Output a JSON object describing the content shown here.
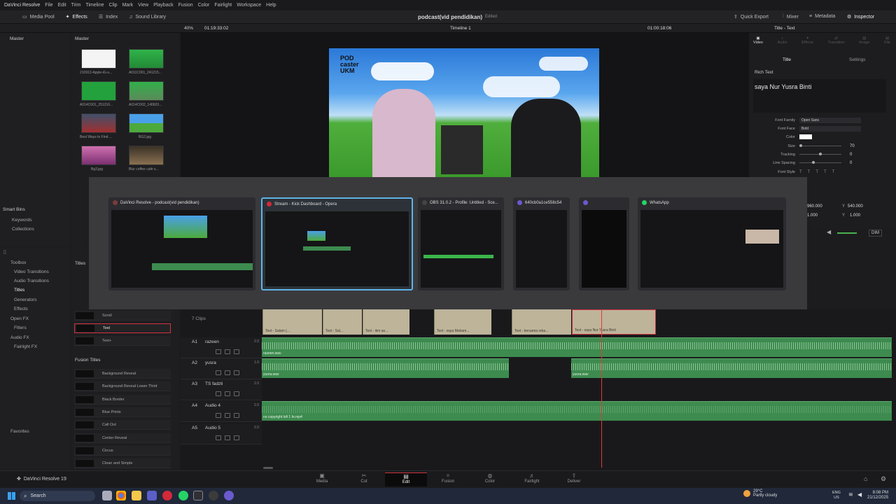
{
  "app": {
    "name": "DaVinci Resolve",
    "project_title": "podcast(vid pendidikan)",
    "edited": "Edited",
    "brand": "DaVinci Resolve 19"
  },
  "menu": [
    "File",
    "Edit",
    "Trim",
    "Timeline",
    "Clip",
    "Mark",
    "View",
    "Playback",
    "Fusion",
    "Color",
    "Fairlight",
    "Workspace",
    "Help"
  ],
  "toolbar": {
    "media_pool": "Media Pool",
    "effects": "Effects",
    "index": "Index",
    "sound_library": "Sound Library",
    "quick_export": "Quick Export",
    "mixer": "Mixer",
    "metadata": "Metadata",
    "inspector": "Inspector"
  },
  "viewer": {
    "zoom": "40%",
    "timecode_left": "01:19:33:02",
    "timeline_name": "Timeline 1",
    "timecode_right": "01:00:18:06",
    "logo_lines": [
      "POD",
      "caster",
      "UKM"
    ]
  },
  "media_pool": {
    "master": "Master",
    "master_bin": "Master",
    "clips": [
      {
        "name": "210912-Apple-iG-s..."
      },
      {
        "name": "A011C001_241215..."
      },
      {
        "name": "A014C001_251216..."
      },
      {
        "name": "A014C002_140620..."
      },
      {
        "name": "Best Ways to Find ..."
      },
      {
        "name": "BG2.jpg"
      },
      {
        "name": "Bg3.jpg"
      },
      {
        "name": "Blur coffee cafe s..."
      }
    ],
    "smart_bins": "Smart Bins",
    "smart_items": [
      "Keywords",
      "Collections"
    ]
  },
  "effects": {
    "tree": [
      {
        "label": "Toolbox"
      },
      {
        "label": "Video Transitions"
      },
      {
        "label": "Audio Transitions"
      },
      {
        "label": "Titles"
      },
      {
        "label": "Generators"
      },
      {
        "label": "Effects"
      },
      {
        "label": "Open FX"
      },
      {
        "label": "Filters"
      },
      {
        "label": "Audio FX"
      },
      {
        "label": "Fairlight FX"
      }
    ],
    "favorites": "Favorites",
    "titles_header": "Titles",
    "titles": [
      "Scroll",
      "Text",
      "Text+"
    ],
    "fusion_header": "Fusion Titles",
    "fusion_titles": [
      "Background Reveal",
      "Background Reveal Lower Third",
      "Black Border",
      "Blue Prints",
      "Call Out",
      "Center Reveal",
      "Circus",
      "Clean and Simple"
    ]
  },
  "timeline": {
    "clip_count": "7 Clips",
    "text_clips": [
      "Text - Salam (...",
      "Text - Sal...",
      "Text - ikm as...",
      "Text - saya Muham...",
      "Text - bersama reka...",
      "Text - saya Nur Yusra Binti"
    ],
    "tracks": [
      {
        "id": "A1",
        "name": "razeen",
        "ch": "2.0",
        "clips": [
          "razeen.wav"
        ]
      },
      {
        "id": "A2",
        "name": "yusra",
        "ch": "1.0",
        "clips": [
          "yusra.wav",
          "yusra.wav"
        ]
      },
      {
        "id": "A3",
        "name": "TS fadzli",
        "ch": "2.0",
        "clips": []
      },
      {
        "id": "A4",
        "name": "Audio 4",
        "ch": "2.0",
        "clips": [
          "no copyright lofi 1 hr.mp4"
        ]
      },
      {
        "id": "A5",
        "name": "Audio 5",
        "ch": "2.0",
        "clips": []
      }
    ]
  },
  "inspector": {
    "title": "Title - Text",
    "tabs": [
      "Video",
      "Audio",
      "Effects",
      "Transition",
      "Image",
      "File"
    ],
    "subtabs": [
      "Title",
      "Settings"
    ],
    "section": "Rich Text",
    "text_value": "saya Nur Yusra Binti",
    "rows": [
      {
        "label": "Font Family",
        "value": "Open Sans"
      },
      {
        "label": "Font Face",
        "value": "Bold"
      },
      {
        "label": "Color",
        "value": ""
      },
      {
        "label": "Size",
        "value": "70"
      },
      {
        "label": "Tracking",
        "value": "0"
      },
      {
        "label": "Line Spacing",
        "value": "0"
      },
      {
        "label": "Font Style",
        "value": ""
      }
    ],
    "pos_x": "960.000",
    "pos_y": "540.000",
    "zoom_x": "1.000",
    "zoom_y": "1.000",
    "y_label": "Y",
    "dim": "DIM"
  },
  "switcher": {
    "windows": [
      {
        "title": "DaVinci Resolve - podcast(vid pendidikan)",
        "color": "#7a3b3b"
      },
      {
        "title": "Stream - Kick Dashboard - Opera",
        "color": "#d3293a"
      },
      {
        "title": "OBS 31.0.2 - Profile: Untitled - Sce...",
        "color": "#444"
      },
      {
        "title": "640cb0a1ce558c54",
        "color": "#6a5acd"
      },
      {
        "title": "",
        "color": "#6a5acd"
      },
      {
        "title": "WhatsApp",
        "color": "#25d366"
      }
    ]
  },
  "pages": [
    "Media",
    "Cut",
    "Edit",
    "Fusion",
    "Color",
    "Fairlight",
    "Deliver"
  ],
  "active_page": "Edit",
  "taskbar": {
    "search": "Search",
    "weather_temp": "29°C",
    "weather_desc": "Partly cloudy",
    "lang1": "ENG",
    "lang2": "US",
    "time": "8:08 PM",
    "date": "21/12/2025"
  }
}
